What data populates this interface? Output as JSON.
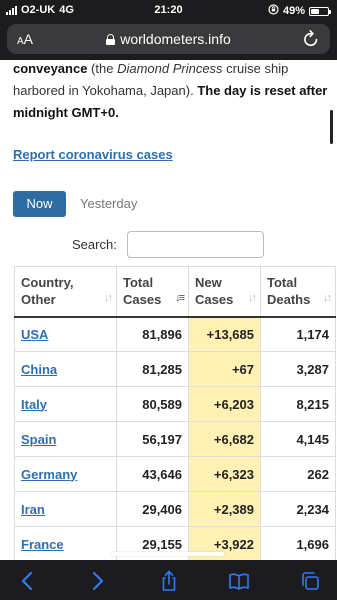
{
  "status_bar": {
    "carrier": "O2-UK",
    "network": "4G",
    "time": "21:20",
    "battery": "49%",
    "battery_level": 0.49
  },
  "browser": {
    "aa_label_small": "A",
    "aa_label_large": "A",
    "url": "worldometers.info"
  },
  "page": {
    "para_line1_prefix": "conveyance",
    "para_line1_mid": " (the ",
    "para_ship": "Diamond Princess",
    "para_line1_suffix": " cruise ship",
    "para_line2": "harbored in Yokohama, Japan). ",
    "para_bold": "The day is reset after",
    "para_bold2": "midnight GMT+0",
    "para_end": ".",
    "report_link": "Report coronavirus cases",
    "tab_now": "Now",
    "tab_yesterday": "Yesterday",
    "search_label": "Search:",
    "search_value": ""
  },
  "table": {
    "headers": [
      {
        "line1": "Country,",
        "line2": "Other"
      },
      {
        "line1": "Total",
        "line2": "Cases"
      },
      {
        "line1": "New",
        "line2": "Cases"
      },
      {
        "line1": "Total",
        "line2": "Deaths"
      }
    ],
    "rows": [
      {
        "country": "USA",
        "total_cases": "81,896",
        "new_cases": "+13,685",
        "total_deaths": "1,174"
      },
      {
        "country": "China",
        "total_cases": "81,285",
        "new_cases": "+67",
        "total_deaths": "3,287"
      },
      {
        "country": "Italy",
        "total_cases": "80,589",
        "new_cases": "+6,203",
        "total_deaths": "8,215"
      },
      {
        "country": "Spain",
        "total_cases": "56,197",
        "new_cases": "+6,682",
        "total_deaths": "4,145"
      },
      {
        "country": "Germany",
        "total_cases": "43,646",
        "new_cases": "+6,323",
        "total_deaths": "262"
      },
      {
        "country": "Iran",
        "total_cases": "29,406",
        "new_cases": "+2,389",
        "total_deaths": "2,234"
      },
      {
        "country": "France",
        "total_cases": "29,155",
        "new_cases": "+3,922",
        "total_deaths": "1,696"
      }
    ]
  },
  "toolbar": {
    "icons": [
      "back-icon",
      "forward-icon",
      "share-icon",
      "bookmarks-icon",
      "tabs-icon"
    ]
  },
  "colors": {
    "accent": "#2e6da4",
    "link": "#2d6fb5",
    "new_cases_bg": "#fff0b3",
    "chrome": "#1c1c1e",
    "toolbar_icon": "#2f7cf6"
  }
}
